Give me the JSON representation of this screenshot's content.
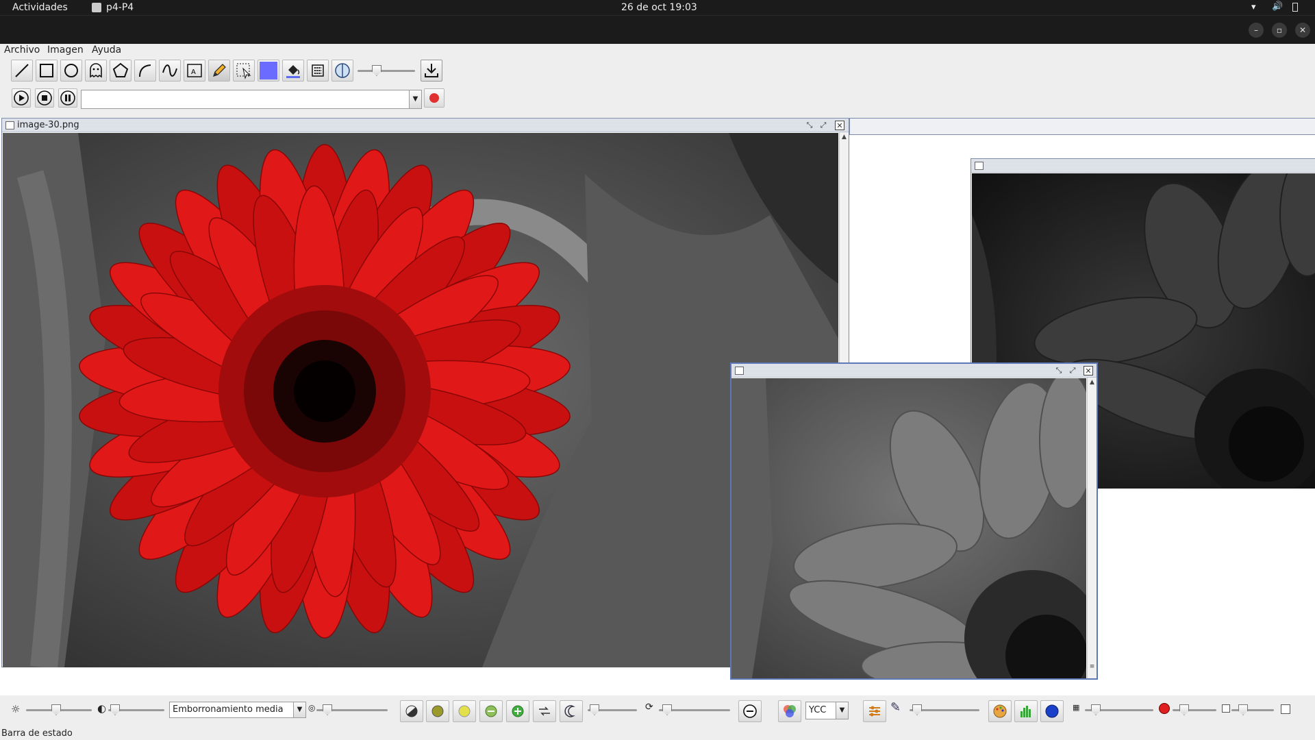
{
  "system": {
    "activities": "Actividades",
    "app_name": "p4-P4",
    "datetime": "26 de oct  19:03"
  },
  "menu": {
    "archivo": "Archivo",
    "imagen": "Imagen",
    "ayuda": "Ayuda"
  },
  "toolbar": {
    "tools": [
      "line-tool",
      "rectangle-tool",
      "ellipse-tool",
      "ghost-shape-tool",
      "polygon-tool",
      "arc-tool",
      "curve-tool",
      "text-image-tool",
      "pencil-tool",
      "select-tool",
      "color-swatch",
      "fill-tool",
      "pattern-tool",
      "transparency-tool"
    ],
    "active_color": "#6b6bff",
    "transparency_slider_value": 0.3
  },
  "playbar": {
    "combo_value": "",
    "record_color": "#e03030"
  },
  "windows": {
    "main": {
      "title": "image-30.png"
    },
    "right_back": {
      "title": ""
    },
    "front": {
      "title": ""
    }
  },
  "bottom": {
    "brightness_value": 0.45,
    "contrast_value": 0.05,
    "filter_combo": "Emborronamiento media",
    "filter_slider_value": 0.1,
    "rotation_slider_value": 0.05,
    "rotation2_slider_value": 0.05,
    "colorspace_combo": "YCC",
    "tint_slider_value": 0.05,
    "threshold_slider_value": 0.1,
    "red_slider_value": 0.2,
    "last_slider_value": 0.2
  },
  "status": {
    "text": "Barra de estado"
  },
  "colors": {
    "topbar": "#1b1b1b",
    "flower_red": "#d21212",
    "accent_blue": "#6b6bff"
  }
}
